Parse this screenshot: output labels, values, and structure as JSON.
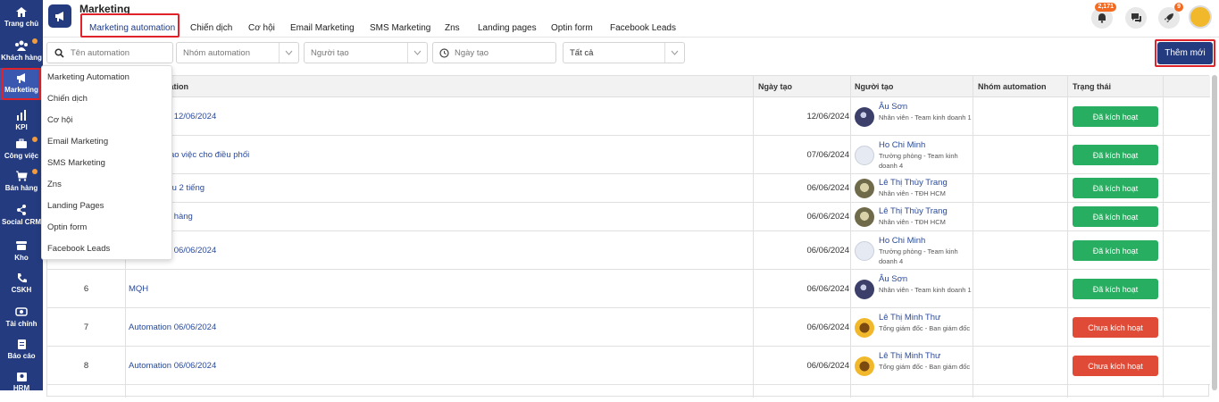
{
  "sidebar": {
    "items": [
      {
        "label": "Trang chủ",
        "icon": "home-icon"
      },
      {
        "label": "Khách hàng",
        "icon": "users-icon"
      },
      {
        "label": "Marketing",
        "icon": "megaphone-icon"
      },
      {
        "label": "KPI",
        "icon": "bar-chart-icon"
      },
      {
        "label": "Công việc",
        "icon": "briefcase-icon"
      },
      {
        "label": "Bán hàng",
        "icon": "cart-icon"
      },
      {
        "label": "Social CRM",
        "icon": "share-icon"
      },
      {
        "label": "Kho",
        "icon": "warehouse-icon"
      },
      {
        "label": "CSKH",
        "icon": "phone-icon"
      },
      {
        "label": "Tài chính",
        "icon": "money-icon"
      },
      {
        "label": "Báo cáo",
        "icon": "report-icon"
      },
      {
        "label": "HRM",
        "icon": "hrm-icon"
      }
    ]
  },
  "header": {
    "title": "Marketing",
    "tabs": [
      "Marketing automation",
      "Chiến dịch",
      "Cơ hội",
      "Email Marketing",
      "SMS Marketing",
      "Zns",
      "Landing pages",
      "Optin form",
      "Facebook Leads"
    ],
    "notif_badge": "2,171",
    "rocket_badge": "9"
  },
  "filters": {
    "name_placeholder": "Tên automation",
    "group_placeholder": "Nhóm automation",
    "creator_placeholder": "Người tạo",
    "date_placeholder": "Ngày tạo",
    "status_value": "Tất cả",
    "add_label": "Thêm mới"
  },
  "table": {
    "headers": {
      "name": "Tên automation",
      "date": "Ngày tạo",
      "creator": "Người tạo",
      "group": "Nhóm automation",
      "status": "Trạng thái"
    },
    "rows": [
      {
        "num": "",
        "name": "Automation 12/06/2024",
        "date": "12/06/2024",
        "user": "Âu Sơn",
        "role": "Nhân viên - Team kinh doanh 1",
        "avatar": "dark",
        "status": "Đã kích hoạt",
        "active": true
      },
      {
        "num": "",
        "name": "Tự động giao việc cho điều phối",
        "date": "07/06/2024",
        "user": "Ho Chi Minh",
        "role": "Trưởng phòng - Team kinh doanh 4",
        "avatar": "blank",
        "status": "Đã kích hoạt",
        "active": true
      },
      {
        "num": "",
        "name": "Gửi mail sau 2 tiếng",
        "date": "06/06/2024",
        "user": "Lê Thị Thùy Trang",
        "role": "Nhân viên - TĐH HCM",
        "avatar": "photo",
        "status": "Đã kích hoạt",
        "active": true
      },
      {
        "num": "",
        "name": "Khách mua hàng",
        "date": "06/06/2024",
        "user": "Lê Thị Thùy Trang",
        "role": "Nhân viên - TĐH HCM",
        "avatar": "photo",
        "status": "Đã kích hoạt",
        "active": true
      },
      {
        "num": "",
        "name": "Automation 06/06/2024",
        "date": "06/06/2024",
        "user": "Ho Chi Minh",
        "role": "Trưởng phòng - Team kinh doanh 4",
        "avatar": "blank",
        "status": "Đã kích hoạt",
        "active": true
      },
      {
        "num": "6",
        "name": "MQH",
        "date": "06/06/2024",
        "user": "Âu Sơn",
        "role": "Nhân viên - Team kinh doanh 1",
        "avatar": "dark",
        "status": "Đã kích hoạt",
        "active": true
      },
      {
        "num": "7",
        "name": "Automation 06/06/2024",
        "date": "06/06/2024",
        "user": "Lê Thị Minh Thư",
        "role": "Tổng giám đốc - Ban giám đốc",
        "avatar": "sunflower",
        "status": "Chưa kích hoạt",
        "active": false
      },
      {
        "num": "8",
        "name": "Automation 06/06/2024",
        "date": "06/06/2024",
        "user": "Lê Thị Minh Thư",
        "role": "Tổng giám đốc - Ban giám đốc",
        "avatar": "sunflower",
        "status": "Chưa kích hoạt",
        "active": false
      }
    ]
  },
  "dropdown": {
    "items": [
      "Marketing Automation",
      "Chiến dịch",
      "Cơ hội",
      "Email Marketing",
      "SMS Marketing",
      "Zns",
      "Landing Pages",
      "Optin form",
      "Facebook Leads"
    ]
  },
  "colors": {
    "sidebar": "#243b7f",
    "active_green": "#27ae60",
    "inactive_red": "#e04b37",
    "highlight": "#e0232a"
  }
}
